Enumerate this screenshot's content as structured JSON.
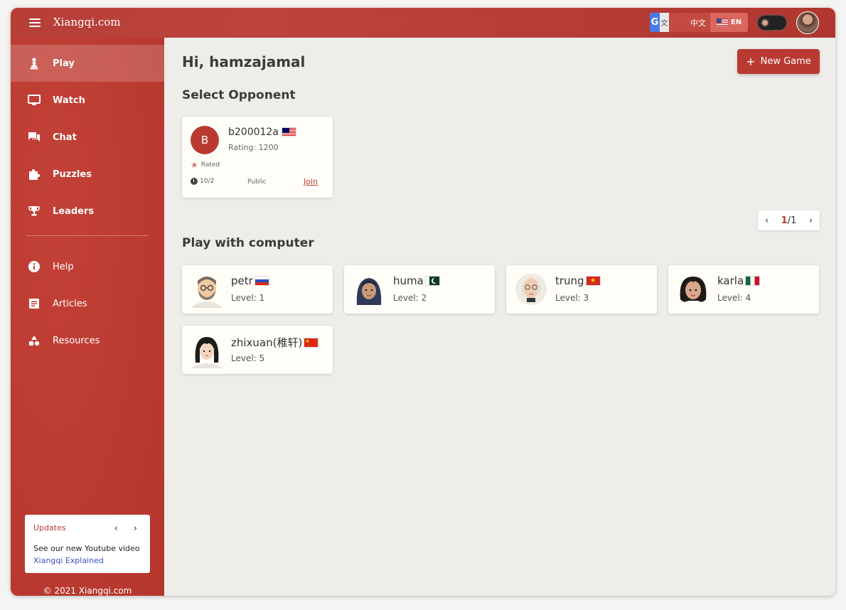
{
  "topbar": {
    "brand": "Xiangqi.com",
    "lang_zh": "中文",
    "lang_en": "EN"
  },
  "sidebar": {
    "items": [
      {
        "label": "Play",
        "icon": "pawn-icon"
      },
      {
        "label": "Watch",
        "icon": "monitor-icon"
      },
      {
        "label": "Chat",
        "icon": "chat-icon"
      },
      {
        "label": "Puzzles",
        "icon": "puzzle-icon"
      },
      {
        "label": "Leaders",
        "icon": "trophy-icon"
      },
      {
        "label": "Help",
        "icon": "info-icon"
      },
      {
        "label": "Articles",
        "icon": "article-icon"
      },
      {
        "label": "Resources",
        "icon": "shapes-icon"
      }
    ],
    "updates": {
      "title": "Updates",
      "text": "See our new Youtube video ",
      "link": "Xiangqi Explained"
    },
    "copyright": "© 2021 Xiangqi.com"
  },
  "main": {
    "greeting": "Hi, hamzajamal",
    "new_game": "New Game",
    "select_opponent": "Select Opponent",
    "opponent": {
      "initial": "B",
      "name": "b200012a",
      "rating": "Rating: 1200",
      "rated": "Rated",
      "time": "10/2",
      "visibility": "Public",
      "join": "Join"
    },
    "pager": {
      "current": "1",
      "total": "/1"
    },
    "play_computer": "Play with computer",
    "computers": [
      {
        "name": "petr",
        "level": "Level: 1",
        "flag": "russia"
      },
      {
        "name": "huma",
        "level": "Level: 2",
        "flag": "pakistan"
      },
      {
        "name": "trung",
        "level": "Level: 3",
        "flag": "vietnam"
      },
      {
        "name": "karla",
        "level": "Level: 4",
        "flag": "mexico"
      },
      {
        "name": "zhixuan(稚轩)",
        "level": "Level: 5",
        "flag": "china"
      }
    ]
  },
  "colors": {
    "brand_red": "#b93a32",
    "sidebar_red": "#c0392f",
    "link_blue": "#3550c8"
  }
}
